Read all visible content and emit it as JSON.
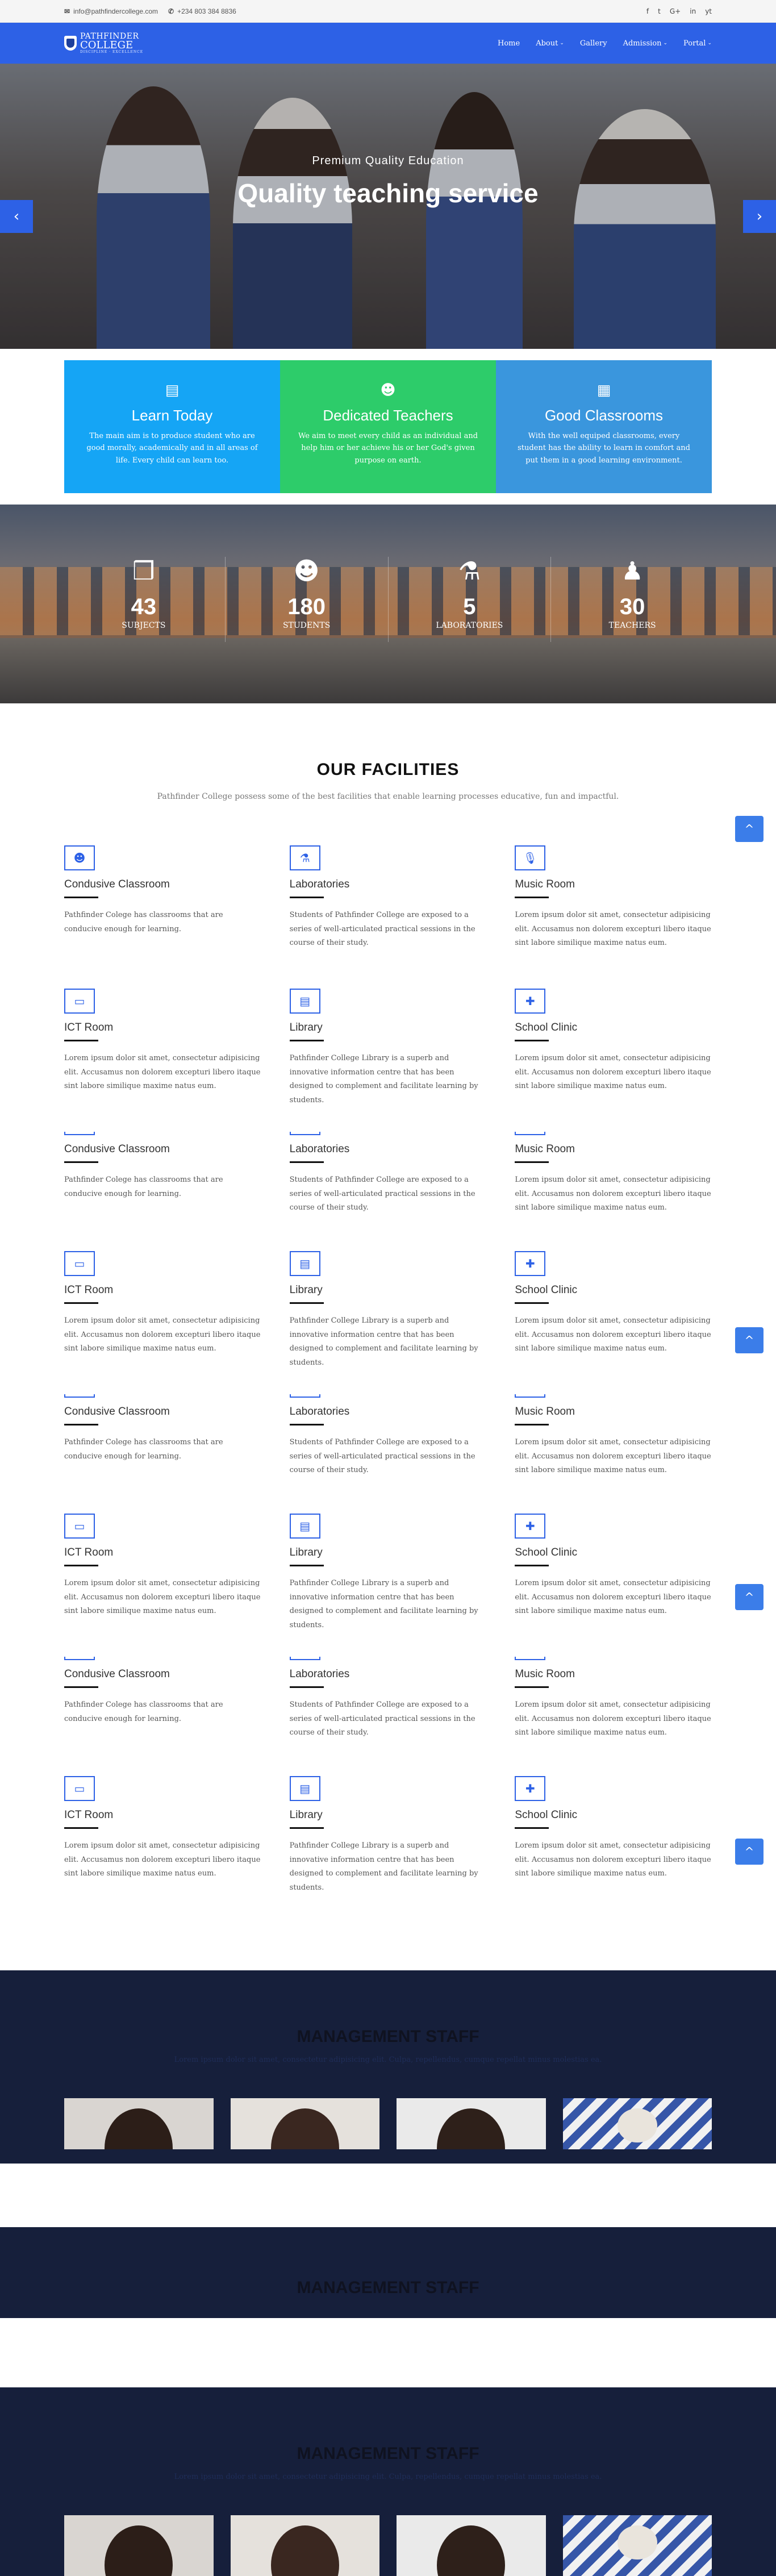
{
  "topbar": {
    "email": "info@pathfindercollege.com",
    "phone": "+234 803 384 8836",
    "social": [
      "f",
      "t",
      "G+",
      "in",
      "yt"
    ]
  },
  "nav": {
    "logo_line1": "PATHFINDER",
    "logo_line2": "COLLEGE",
    "logo_tag": "DISCIPLINE · EXCELLENCE",
    "items": [
      "Home",
      "About",
      "Gallery",
      "Admission",
      "Portal"
    ]
  },
  "hero": {
    "eyebrow": "Premium Quality Education",
    "title": "Quality teaching service",
    "prev": "‹",
    "next": "›"
  },
  "features": [
    {
      "title": "Learn Today",
      "text": "The main aim is to produce student who are good morally, academically and in all areas of life. Every child can learn too.",
      "color": "#15a5f5"
    },
    {
      "title": "Dedicated Teachers",
      "text": "We aim to meet every child as an individual and help him or her achieve his or her God's given purpose on earth.",
      "color": "#2dcc6a"
    },
    {
      "title": "Good Classrooms",
      "text": "With the well equiped classrooms, every student has the ability to learn in comfort and put them in a good learning environment.",
      "color": "#3a96dd"
    }
  ],
  "stats": [
    {
      "value": "43",
      "label": "Subjects"
    },
    {
      "value": "180",
      "label": "Students"
    },
    {
      "value": "5",
      "label": "Laboratories"
    },
    {
      "value": "30",
      "label": "Teachers"
    }
  ],
  "facilities": {
    "title": "OUR FACILITIES",
    "subtitle": "Pathfinder College possess some of the best facilities that enable learning processes educative, fun and impactful.",
    "rows": [
      [
        {
          "title": "Condusive Classroom",
          "text": "Pathfinder Colege has classrooms that are conducive enough for learning."
        },
        {
          "title": "Laboratories",
          "text": "Students of Pathfinder College are exposed to a series of well-articulated practical sessions in the course of their study."
        },
        {
          "title": "Music Room",
          "text": "Lorem ipsum dolor sit amet, consectetur adipisicing elit. Accusamus non dolorem excepturi libero itaque sint labore similique maxime natus eum."
        }
      ],
      [
        {
          "title": "ICT Room",
          "text": "Lorem ipsum dolor sit amet, consectetur adipisicing elit. Accusamus non dolorem excepturi libero itaque sint labore similique maxime natus eum."
        },
        {
          "title": "Library",
          "text": "Pathfinder College Library is a superb and innovative information centre that has been designed to complement and facilitate learning by students."
        },
        {
          "title": "School Clinic",
          "text": "Lorem ipsum dolor sit amet, consectetur adipisicing elit. Accusamus non dolorem excepturi libero itaque sint labore similique maxime natus eum."
        }
      ]
    ]
  },
  "management": {
    "title": "MANAGEMENT STAFF",
    "subtitle": "Lorem ipsum dolor sit amet, consectetur adipisicing elit. Culpa, repellendus, cumque repellat minus molestias ea."
  },
  "totop": "^"
}
